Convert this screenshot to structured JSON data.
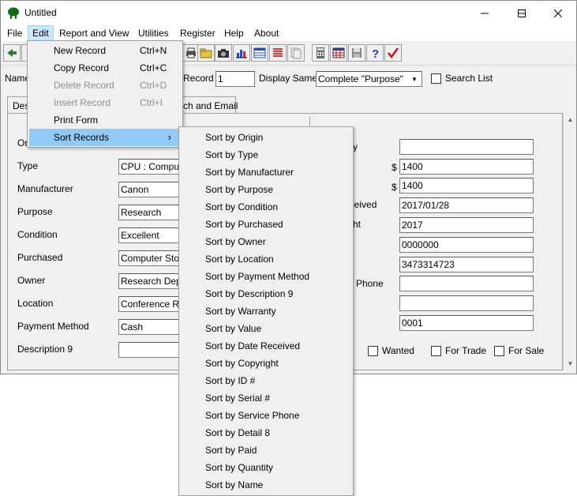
{
  "window": {
    "title": "Untitled"
  },
  "menubar": [
    {
      "label": "File"
    },
    {
      "label": "Edit"
    },
    {
      "label": "Report and View"
    },
    {
      "label": "Utilities"
    },
    {
      "label": "Register"
    },
    {
      "label": "Help"
    },
    {
      "label": "About"
    }
  ],
  "row2": {
    "name_label": "Name",
    "record_label": "Record",
    "record_value": "1",
    "display_same_label": "Display Same",
    "display_same_value": "Complete \"Purpose\"",
    "search_list_label": "Search List"
  },
  "tabs": {
    "first": "Des",
    "second": "ch and Email"
  },
  "left_fields": [
    {
      "label": "Ori",
      "value": ""
    },
    {
      "label": "Type",
      "value": "CPU : Computer"
    },
    {
      "label": "Manufacturer",
      "value": "Canon"
    },
    {
      "label": "Purpose",
      "value": "Research"
    },
    {
      "label": "Condition",
      "value": "Excellent"
    },
    {
      "label": "Purchased",
      "value": "Computer Store"
    },
    {
      "label": "Owner",
      "value": "Research Depa"
    },
    {
      "label": "Location",
      "value": "Conference Roo"
    },
    {
      "label": "Payment Method",
      "value": "Cash"
    },
    {
      "label": "Description 9",
      "value": ""
    }
  ],
  "right_fields": [
    {
      "label": "y",
      "prefix": "",
      "value": ""
    },
    {
      "label": "",
      "prefix": "$",
      "value": "1400"
    },
    {
      "label": "",
      "prefix": "$",
      "value": "1400"
    },
    {
      "label": "eceived",
      "prefix": "",
      "value": "2017/01/28"
    },
    {
      "label": "ht",
      "prefix": "",
      "value": "2017"
    },
    {
      "label": "",
      "prefix": "",
      "value": "0000000"
    },
    {
      "label": "",
      "prefix": "",
      "value": "3473314723"
    },
    {
      "label": "Phone",
      "prefix": "",
      "value": ""
    },
    {
      "label": "",
      "prefix": "",
      "value": ""
    },
    {
      "label": "",
      "prefix": "",
      "value": "0001"
    }
  ],
  "checkboxes": [
    {
      "label": "Wanted"
    },
    {
      "label": "For Trade"
    },
    {
      "label": "For Sale"
    }
  ],
  "edit_menu": [
    {
      "label": "New Record",
      "shortcut": "Ctrl+N",
      "disabled": false
    },
    {
      "label": "Copy Record",
      "shortcut": "Ctrl+C",
      "disabled": false
    },
    {
      "label": "Delete Record",
      "shortcut": "Ctrl+D",
      "disabled": true
    },
    {
      "label": "Insert Record",
      "shortcut": "Ctrl+I",
      "disabled": true
    },
    {
      "label": "Print Form",
      "shortcut": "",
      "disabled": false
    },
    {
      "label": "Sort Records",
      "shortcut": "",
      "disabled": false,
      "submenu_arrow": "›"
    }
  ],
  "sort_submenu": [
    "Sort by Origin",
    "Sort by Type",
    "Sort by Manufacturer",
    "Sort by Purpose",
    "Sort by Condition",
    "Sort by Purchased",
    "Sort by Owner",
    "Sort by Location",
    "Sort by Payment Method",
    "Sort by Description 9",
    "Sort by Warranty",
    "Sort by Value",
    "Sort by Date Received",
    "Sort by Copyright",
    "Sort by ID #",
    "Sort by Serial #",
    "Sort by Service Phone",
    "Sort by Detail 8",
    "Sort by Paid",
    "Sort by Quantity",
    "Sort by Name"
  ],
  "colors": {
    "highlight": "#91c9f7",
    "menu_active": "#cce8ff",
    "disabled_text": "#8f8f8f"
  }
}
